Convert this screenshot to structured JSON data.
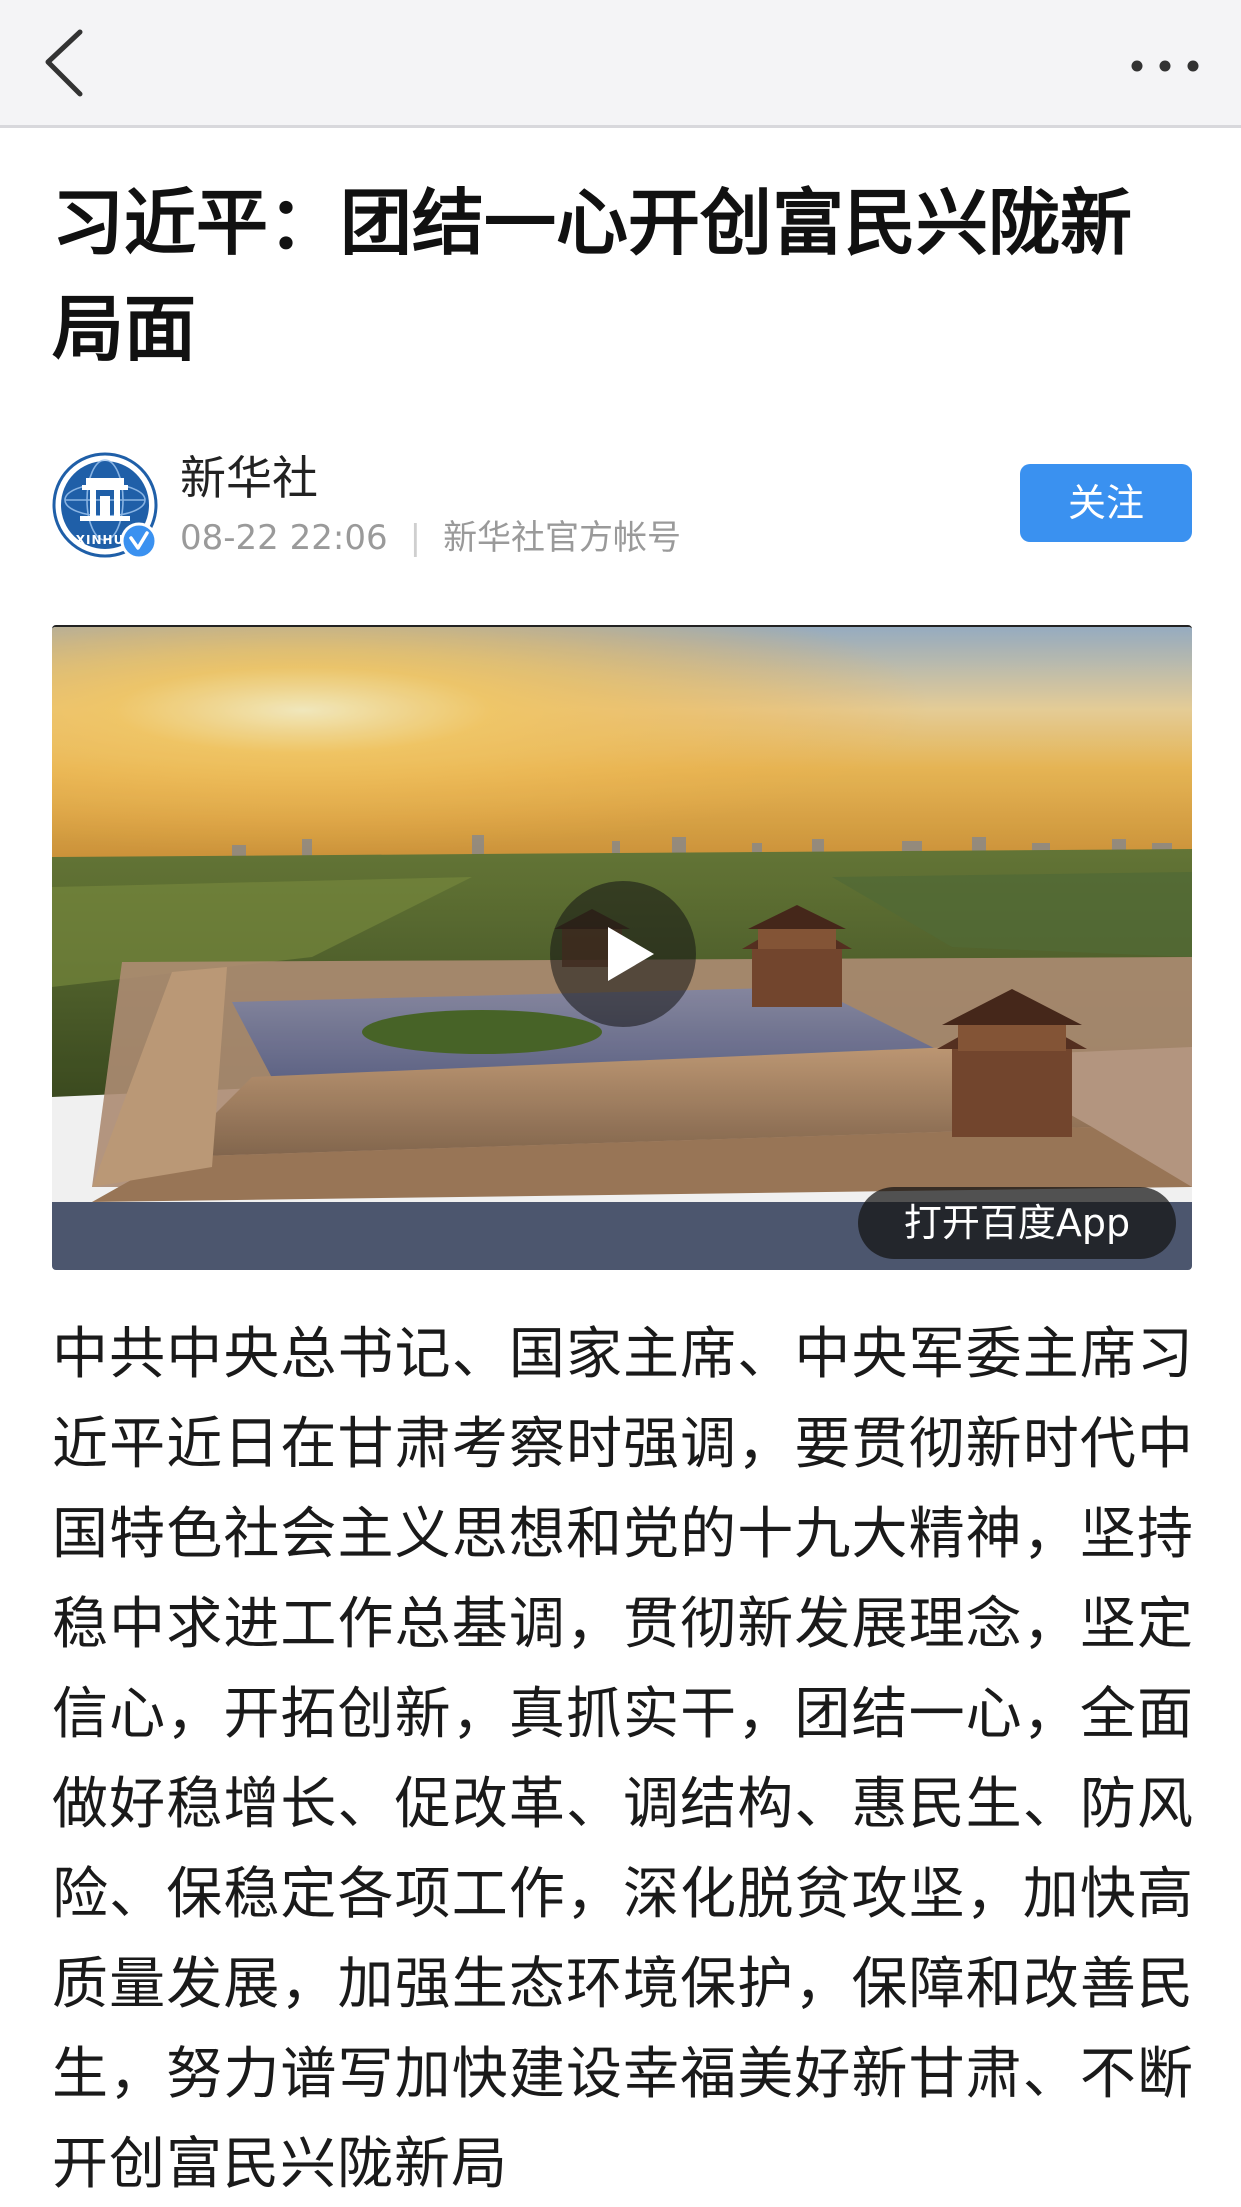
{
  "nav": {
    "back_icon": "chevron-left-icon",
    "more_icon": "more-horizontal-icon"
  },
  "article": {
    "title": "习近平：团结一心开创富民兴陇新局面",
    "author": {
      "name": "新华社",
      "avatar_logo_text": "XINHUA",
      "verified_icon": "verified-icon",
      "date": "08-22 22:06",
      "account_desc": "新华社官方帐号"
    },
    "follow_label": "关注",
    "video": {
      "play_icon": "play-icon",
      "open_app_label": "打开百度App"
    },
    "body": "中共中央总书记、国家主席、中央军委主席习近平近日在甘肃考察时强调，要贯彻新时代中国特色社会主义思想和党的十九大精神，坚持稳中求进工作总基调，贯彻新发展理念，坚定信心，开拓创新，真抓实干，团结一心，全面做好稳增长、促改革、调结构、惠民生、防风险、保稳定各项工作，深化脱贫攻坚，加快高质量发展，加强生态环境保护，保障和改善民生，努力谱写加快建设幸福美好新甘肃、不断开创富民兴陇新局"
  },
  "colors": {
    "nav_bg": "#f4f4f6",
    "follow_bg": "#3a91f0",
    "meta_text": "#9a9a9a",
    "xinhua_blue": "#1f5fa8"
  }
}
